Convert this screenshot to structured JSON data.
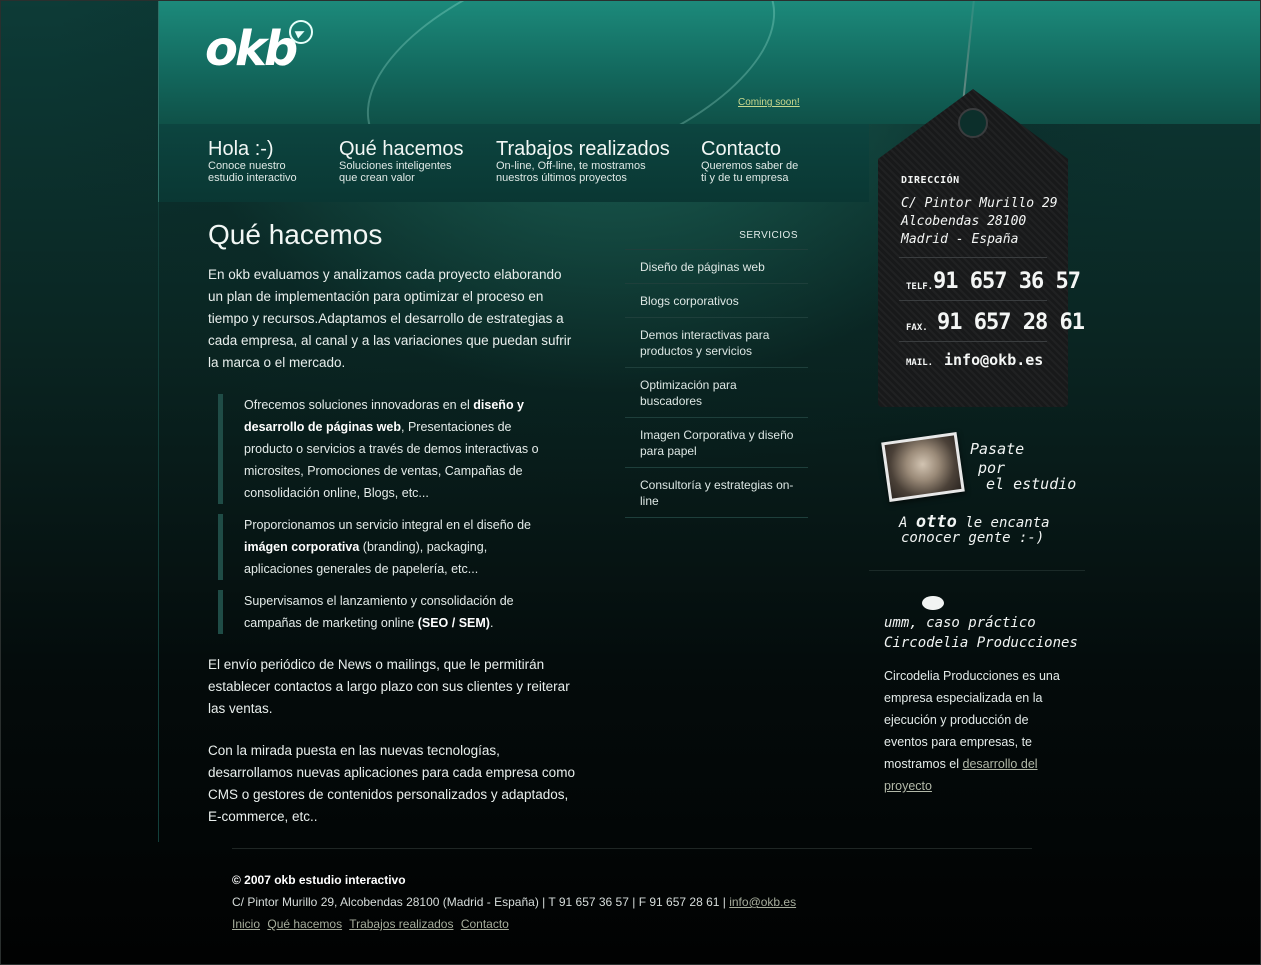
{
  "brand": {
    "logo_text": "okb"
  },
  "header": {
    "coming_soon": "Coming soon!"
  },
  "nav": [
    {
      "title": "Hola :-)",
      "sub": "Conoce nuestro\nestudio interactivo"
    },
    {
      "title": "Qué hacemos",
      "sub": "Soluciones inteligentes\nque crean valor"
    },
    {
      "title": "Trabajos realizados",
      "sub": "On-line, Off-line, te mostramos\nnuestros últimos proyectos"
    },
    {
      "title": "Contacto",
      "sub": "Queremos saber de\nti y de tu empresa"
    }
  ],
  "main": {
    "title": "Qué hacemos",
    "intro": "En okb evaluamos y analizamos cada proyecto elaborando un plan de implementación para optimizar el proceso en tiempo y recursos.Adaptamos el desarrollo de estrategias a cada empresa, al canal y a las variaciones que puedan sufrir la marca o el mercado.",
    "quote1": {
      "a": "Ofrecemos soluciones innovadoras en el ",
      "b": "diseño y desarrollo de páginas web",
      "c": ", Presentaciones de producto o servicios a través de demos interactivas o microsites, Promociones de ventas, Campañas de consolidación online, Blogs, etc..."
    },
    "quote2": {
      "a": "Proporcionamos un servicio integral en el diseño de ",
      "b": "imágen corporativa",
      "c": " (branding), packaging, aplicaciones generales de papelería, etc..."
    },
    "quote3": {
      "a": "Supervisamos el lanzamiento y consolidación de campañas de marketing online ",
      "b": "(SEO / SEM)",
      "c": "."
    },
    "para2": "El envío periódico de News o mailings, que le permitirán establecer contactos a largo plazo con sus clientes y reiterar las ventas.",
    "para3": "Con la mirada puesta en las nuevas tecnologías, desarrollamos nuevas aplicaciones para cada empresa como CMS o gestores de contenidos personalizados y adaptados, E-commerce, etc.."
  },
  "services": {
    "heading": "SERVICIOS",
    "items": [
      "Diseño de páginas web",
      "Blogs corporativos",
      "Demos interactivas para productos y servicios",
      "Optimización para buscadores",
      "Imagen Corporativa y diseño para papel",
      "Consultoría y estrategias on-line"
    ]
  },
  "contact_tag": {
    "label": "DIRECCIÓN",
    "address": [
      "C/ Pintor Murillo 29",
      "Alcobendas 28100",
      "Madrid - España"
    ],
    "tel_label": "TELF.",
    "tel": "91 657 36 57",
    "fax_label": "FAX.",
    "fax": "91 657 28 61",
    "mail_label": "MAIL.",
    "mail": "info@okb.es"
  },
  "studio": {
    "line1": "Pasate",
    "line2": "por",
    "line3": "el estudio",
    "note_a": "A",
    "note_otto": "otto",
    "note_b": "le encanta",
    "note_c": "conocer gente :-)"
  },
  "case_study": {
    "heading1": "umm, caso práctico",
    "heading2": "Circodelia Producciones",
    "text": "Circodelia Producciones es una empresa especializada en la ejecución y producción de eventos para empresas, te mostramos el ",
    "link": "desarrollo del proyecto"
  },
  "footer": {
    "copyright": "© 2007 okb estudio interactivo",
    "address": "C/ Pintor Murillo 29, Alcobendas 28100 (Madrid - España) | T 91 657 36 57 | F 91 657 28 61 | ",
    "email": "info@okb.es",
    "links": [
      "Inicio",
      "Qué hacemos",
      "Trabajos realizados",
      "Contacto"
    ]
  }
}
